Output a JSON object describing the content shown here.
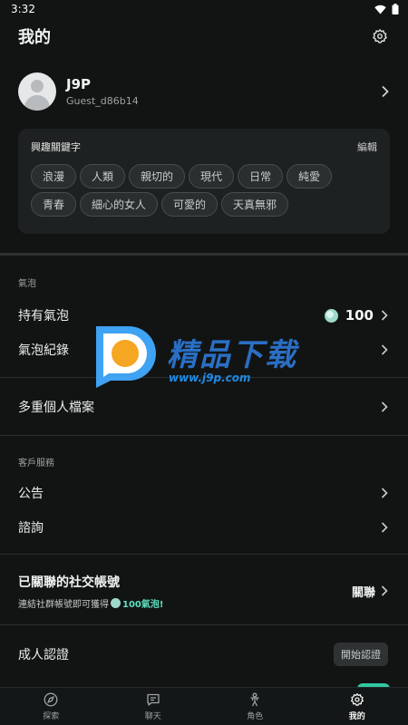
{
  "status": {
    "time": "3:32"
  },
  "header": {
    "title": "我的"
  },
  "profile": {
    "name": "J9P",
    "id": "Guest_d86b14"
  },
  "interests": {
    "title": "興趣關鍵字",
    "edit": "編輯",
    "tags": [
      "浪漫",
      "人類",
      "親切的",
      "現代",
      "日常",
      "純愛",
      "青春",
      "細心的女人",
      "可愛的",
      "天真無邪"
    ]
  },
  "bubbles": {
    "section": "氣泡",
    "own_label": "持有氣泡",
    "own_count": "100",
    "history_label": "氣泡紀錄"
  },
  "profiles": {
    "label": "多重個人檔案"
  },
  "service": {
    "section": "客戶服務",
    "notice": "公告",
    "inquiry": "諮詢"
  },
  "social": {
    "title": "已關聯的社交帳號",
    "subtitle": "連結社群帳號即可獲得",
    "bonus": "100氣泡!",
    "link": "關聯"
  },
  "adult": {
    "label": "成人認證",
    "button": "開始認證"
  },
  "watermark": {
    "brand": "精品下载",
    "url": "www.j9p.com"
  },
  "tabs": [
    {
      "label": "探索",
      "icon": "compass-icon"
    },
    {
      "label": "聊天",
      "icon": "chat-icon"
    },
    {
      "label": "角色",
      "icon": "person-icon"
    },
    {
      "label": "我的",
      "icon": "gear-icon"
    }
  ],
  "colors": {
    "background": "#121414",
    "card": "#1E2121",
    "accent": "#31C8A2",
    "bonus": "#5EE0C0"
  }
}
